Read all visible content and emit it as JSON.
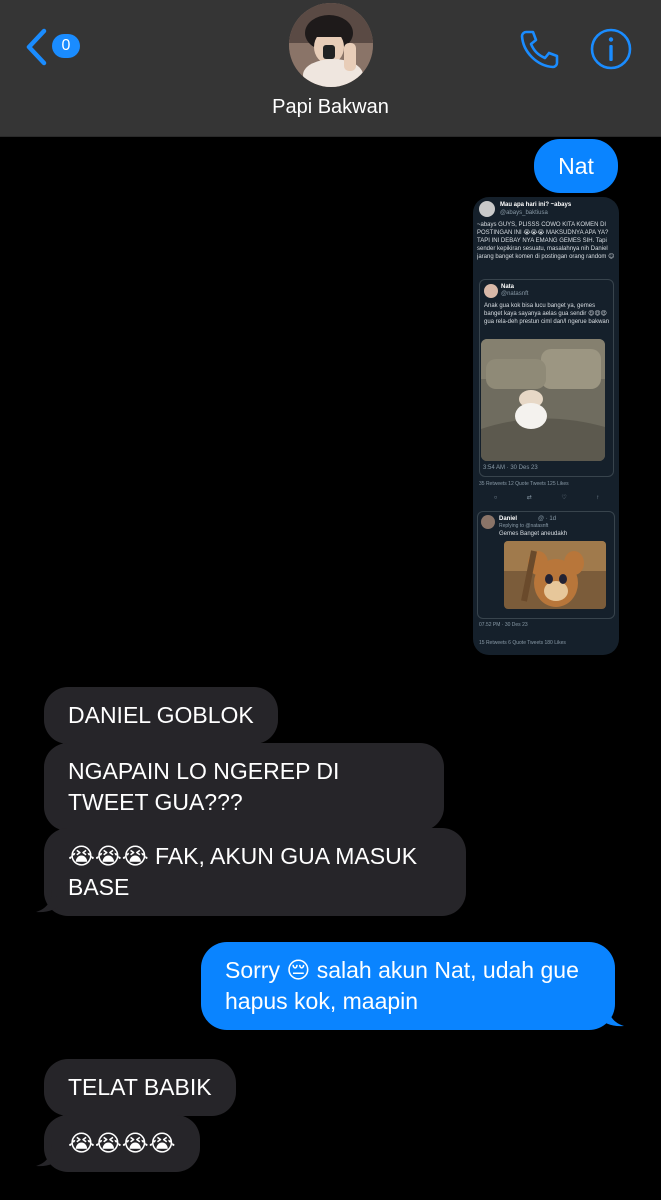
{
  "header": {
    "back_count": "0",
    "contact_name": "Papi Bakwan"
  },
  "icons": {
    "back": "chevron-left-icon",
    "call": "phone-icon",
    "info": "info-icon"
  },
  "colors": {
    "outgoing": "#0a84ff",
    "incoming": "#262529",
    "header": "#353535"
  },
  "messages": {
    "m1": "Nat",
    "m3": "DANIEL GOBLOK",
    "m4": "NGAPAIN LO NGEREP DI TWEET GUA???",
    "m5_emoji": "😭😭😭",
    "m5_text": "FAK, AKUN GUA MASUK BASE",
    "m6_pre": "Sorry",
    "m6_emoji": "😔",
    "m6_post": "salah akun Nat, udah gue hapus kok, maapin",
    "m7": "TELAT BABIK",
    "m8": "😭😭😭😭"
  },
  "tweet": {
    "account": "Mau apa hari ini? ~abays",
    "handle": "@abays_baktiusa",
    "body": "~abays GUYS, PLISSS COWO KITA KOMEN DI POSTINGAN INI 😭😭😭 MAKSUDNYA APA YA? TAPI INI DEBAY NYA EMANG GEMES SIH. Tapi sender kepikiran sesuatu, masalahnya nih Daniel jarang banget komen di postingan orang random 😊",
    "quoted_name": "Nata",
    "quoted_handle": "@natasnft",
    "quoted_body": "Anak gua kok bisa lucu banget ya, gemes banget kaya sayanya aelas gua sendir 😍😍😍 gua rela-deh prestun ciml dan/l ngerue bakwan",
    "quoted_time": "3:54 AM · 30 Des 23",
    "stats": "35 Retweets  12 Quote Tweets  125 Likes",
    "reply_name": "Daniel",
    "reply_meta": "@ · 1d",
    "reply_to": "Replying to @natasnft",
    "reply_text": "Gemes Banget aneudakh",
    "footer_time": "07.52 PM · 30 Des 23",
    "footer_stats": "15 Retweets  6 Quote Tweets  180 Likes"
  }
}
